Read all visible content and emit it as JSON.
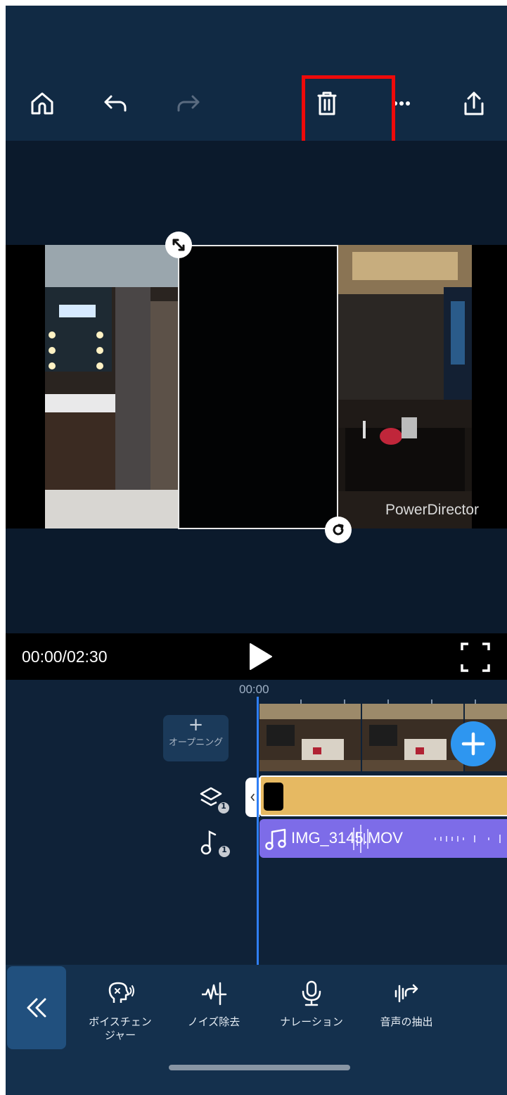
{
  "toolbar": {
    "icons": [
      "home-icon",
      "undo-icon",
      "redo-icon",
      "trash-icon",
      "more-icon",
      "share-icon"
    ],
    "highlight_color": "#ee0a0a"
  },
  "preview": {
    "watermark": "PowerDirector"
  },
  "playback": {
    "timecode": "00:00/02:30"
  },
  "timeline": {
    "ruler_time": "00:00",
    "opening_button": {
      "plus": "+",
      "label": "オープニング"
    },
    "layer_count": "1",
    "audio_count": "1",
    "audio_clip_name": "IMG_3145.MOV",
    "playhead_color": "#2f7ff5",
    "overlay_track_color": "#e6b962",
    "audio_track_color": "#7d6ce8"
  },
  "tools": [
    {
      "label": "ボイスチェン\nジャー",
      "icon": "voice-changer-icon"
    },
    {
      "label": "ノイズ除去",
      "icon": "noise-removal-icon"
    },
    {
      "label": "ナレーション",
      "icon": "microphone-icon"
    },
    {
      "label": "音声の抽出",
      "icon": "audio-extract-icon"
    }
  ]
}
